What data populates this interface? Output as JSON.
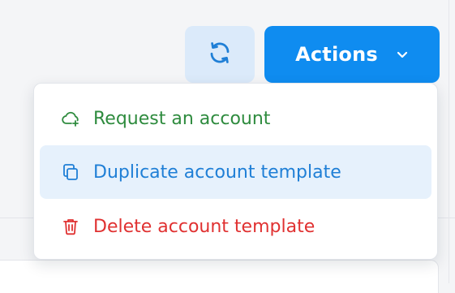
{
  "toolbar": {
    "refresh_icon": "refresh-icon",
    "actions_label": "Actions",
    "actions_icon": "chevron-down-icon"
  },
  "menu": {
    "items": [
      {
        "label": "Request an account",
        "icon": "cloud-plus-icon",
        "color": "#2e8b3e"
      },
      {
        "label": "Duplicate account template",
        "icon": "copy-icon",
        "color": "#1f7fd6",
        "highlighted": true
      },
      {
        "label": "Delete account template",
        "icon": "trash-icon",
        "color": "#e03131"
      }
    ]
  },
  "colors": {
    "primary": "#0f8cf0",
    "refresh_bg": "#dbeafa",
    "highlight_bg": "#e6f1fc"
  }
}
